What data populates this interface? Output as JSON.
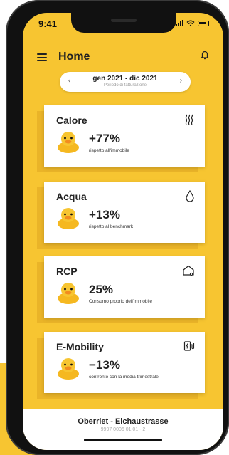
{
  "status_bar": {
    "time": "9:41"
  },
  "header": {
    "title": "Home"
  },
  "period": {
    "range": "gen 2021 - dic 2021",
    "subtitle": "Periodo di fatturazione",
    "prev_symbol": "‹",
    "next_symbol": "›"
  },
  "cards": [
    {
      "title": "Calore",
      "value": "+77%",
      "caption": "rispetto all'immobile",
      "icon": "heat-icon"
    },
    {
      "title": "Acqua",
      "value": "+13%",
      "caption": "rispetto al benchmark",
      "icon": "water-drop-icon"
    },
    {
      "title": "RCP",
      "value": "25%",
      "caption": "Consumo proprio dell'immobile",
      "icon": "house-plug-icon"
    },
    {
      "title": "E-Mobility",
      "value": "−13%",
      "caption": "confronto con la media trimestrale",
      "icon": "ev-charger-icon"
    }
  ],
  "property": {
    "name": "Oberriet - Eichaustrasse",
    "code": "9997 0006 01 01 - 2"
  },
  "colors": {
    "accent": "#f7c531",
    "accent_dark": "#eab428",
    "card": "#ffffff",
    "text": "#222222"
  }
}
